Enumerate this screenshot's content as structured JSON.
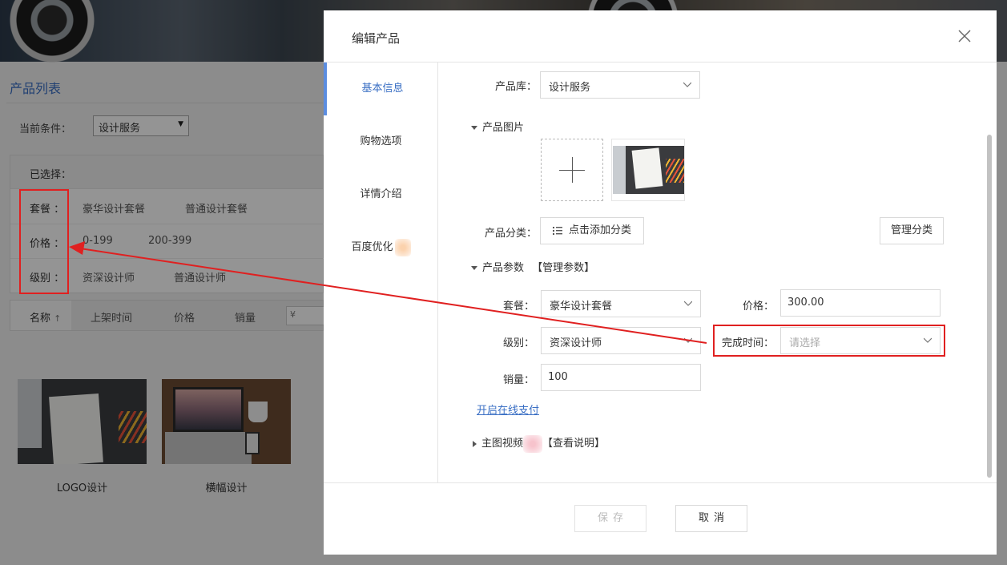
{
  "background": {
    "list_title": "产品列表",
    "condition_label": "当前条件：",
    "condition_value": "设计服务",
    "selected_label": "已选择：",
    "filters": [
      {
        "label": "套餐 ：",
        "options": [
          "豪华设计套餐",
          "普通设计套餐"
        ]
      },
      {
        "label": "价格 ：",
        "options": [
          "0-199",
          "200-399"
        ]
      },
      {
        "label": "级别 ：",
        "options": [
          "资深设计师",
          "普通设计师"
        ]
      }
    ],
    "sort": {
      "name": "名称",
      "name_arrow": "↑",
      "time": "上架时间",
      "price": "价格",
      "sales": "销量",
      "price_placeholder": "¥"
    },
    "products": [
      {
        "name": "LOGO设计"
      },
      {
        "name": "横幅设计"
      }
    ]
  },
  "dialog": {
    "title": "编辑产品",
    "tabs": [
      "基本信息",
      "购物选项",
      "详情介绍",
      "百度优化"
    ],
    "active_tab": 0,
    "form": {
      "library_label": "产品库：",
      "library_value": "设计服务",
      "images_label": "产品图片",
      "category_label": "产品分类：",
      "category_button": "点击添加分类",
      "manage_category_button": "管理分类",
      "params_label": "产品参数",
      "manage_params": "【管理参数】",
      "package_label": "套餐：",
      "package_value": "豪华设计套餐",
      "price_label": "价格：",
      "price_value": "300.00",
      "level_label": "级别：",
      "level_value": "资深设计师",
      "finish_time_label": "完成时间：",
      "finish_time_placeholder": "请选择",
      "sales_label": "销量：",
      "sales_value": "100",
      "online_pay_link": "开启在线支付",
      "video_label": "主图视频",
      "video_help": "【查看说明】"
    },
    "footer": {
      "save": "保存",
      "cancel": "取消"
    }
  },
  "colors": {
    "accent": "#3a6fc4",
    "annotation": "#e02020"
  }
}
